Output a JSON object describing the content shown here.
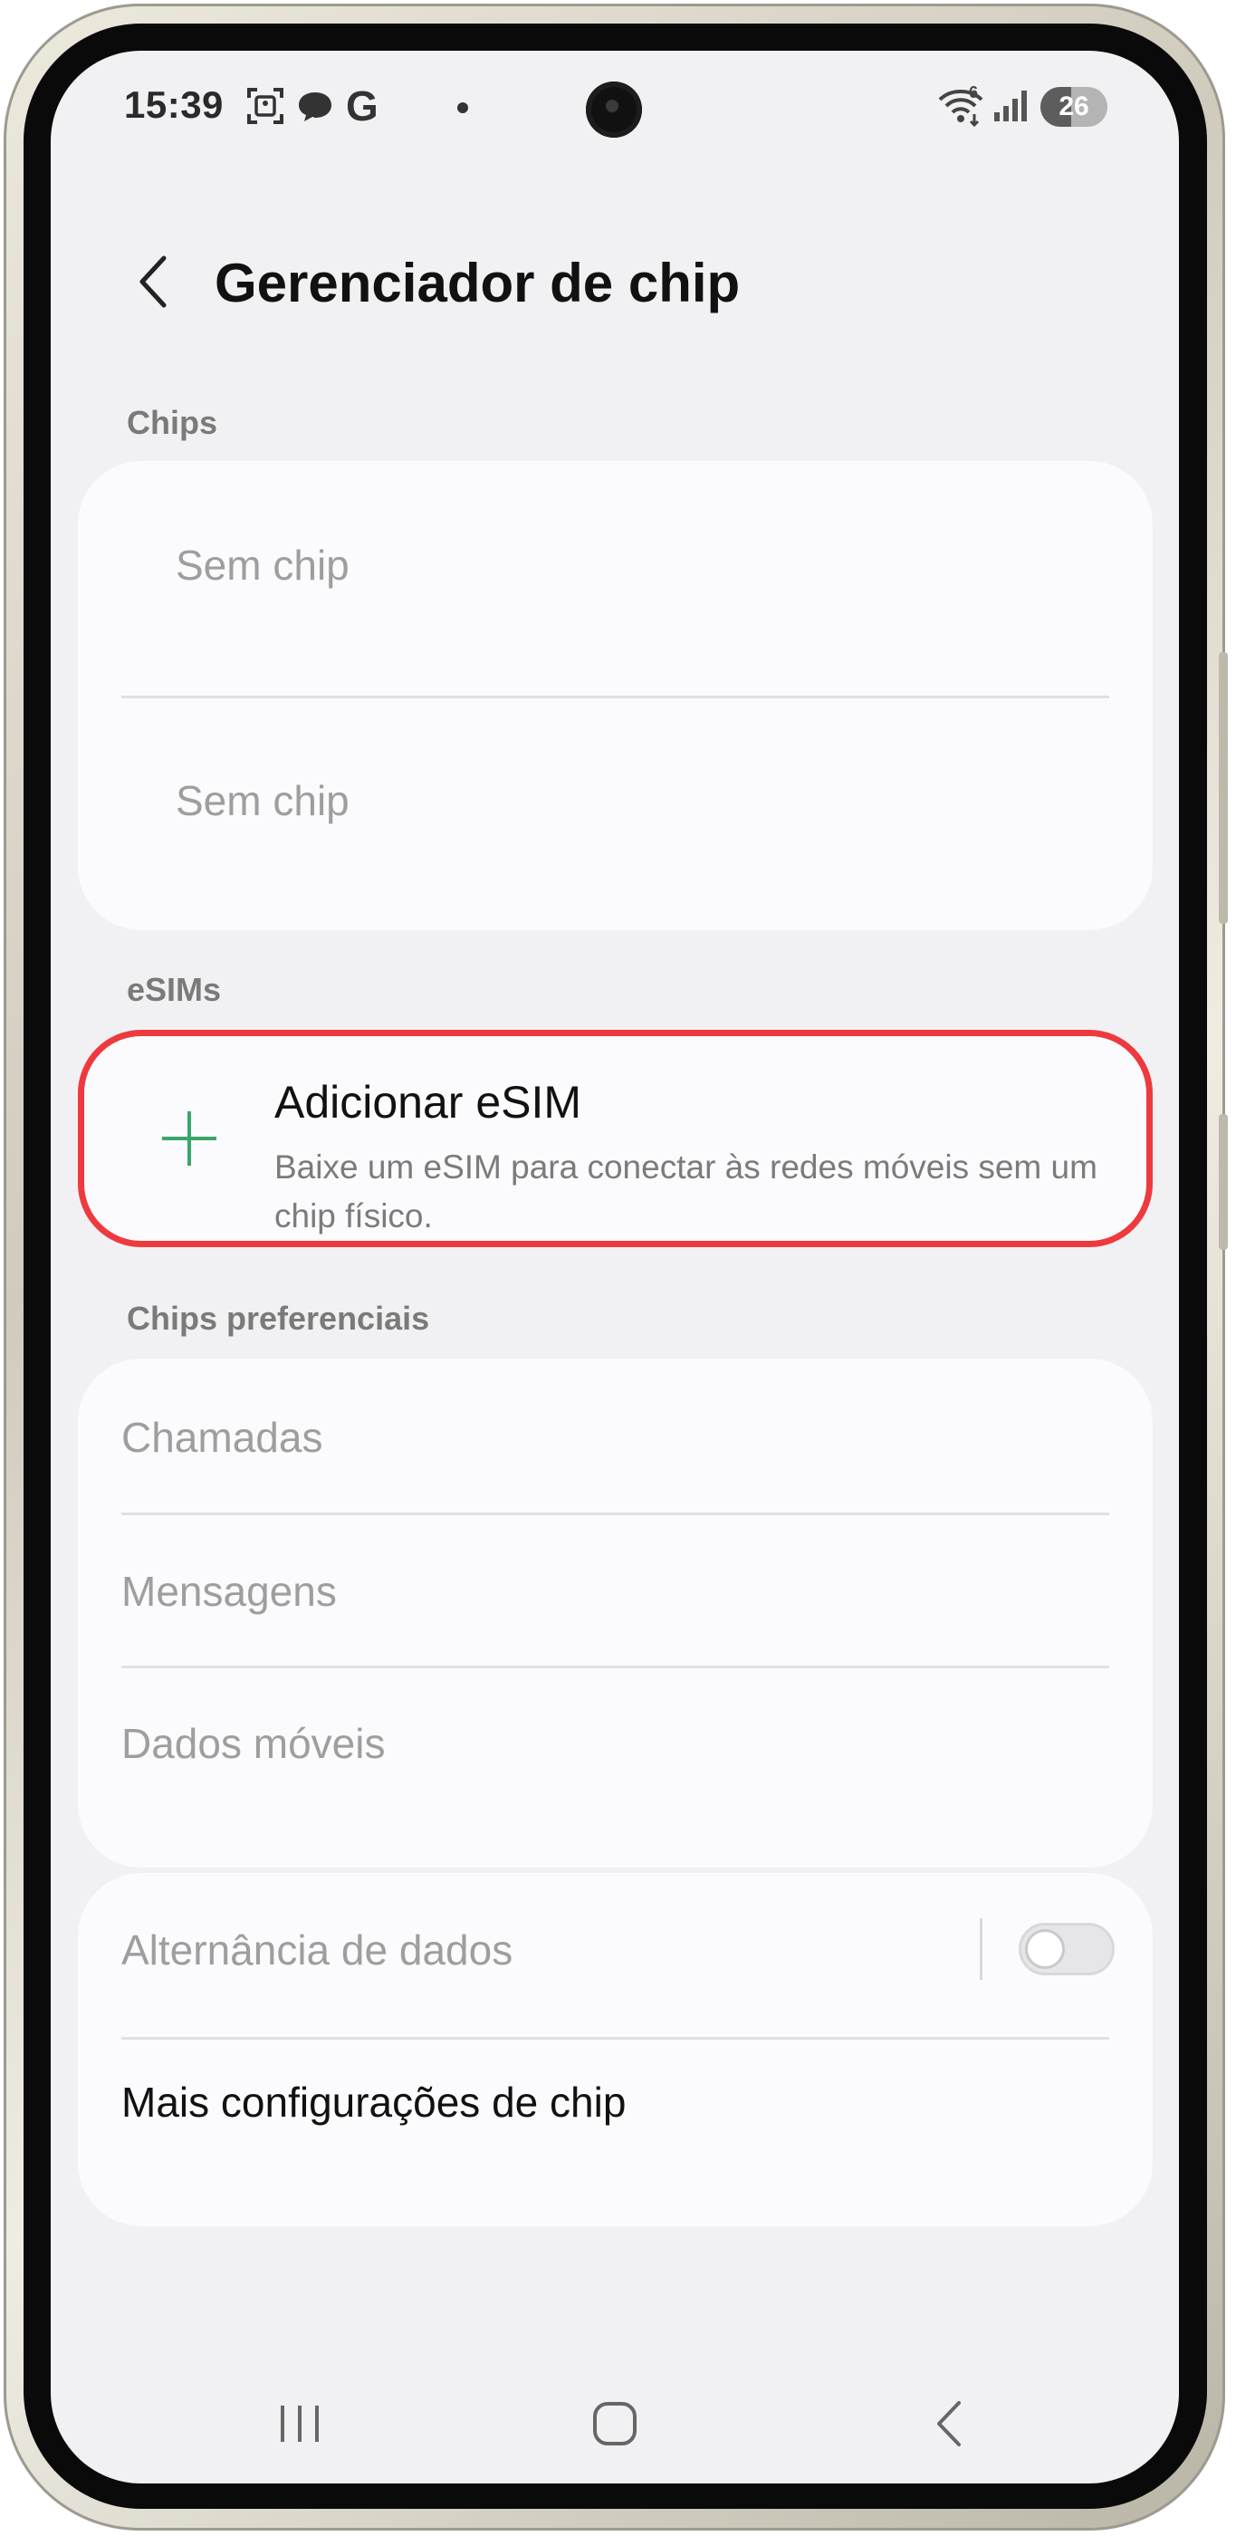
{
  "status_bar": {
    "time": "15:39",
    "icons": [
      "screenshot-icon",
      "chat-bubble-icon",
      "google-g-icon",
      "dot-icon"
    ],
    "google_letter": "G",
    "right_icons": [
      "wifi-6-icon",
      "signal-icon"
    ],
    "wifi_badge": "6",
    "battery_level": "26"
  },
  "header": {
    "title": "Gerenciador de chip"
  },
  "chips": {
    "section_label": "Chips",
    "items": [
      "Sem chip",
      "Sem chip"
    ]
  },
  "esims": {
    "section_label": "eSIMs",
    "add_title": "Adicionar eSIM",
    "add_desc": "Baixe um eSIM para conectar às redes móveis sem um chip físico.",
    "highlight_color": "#ee3a3f",
    "accent_color": "#3aa66a"
  },
  "preferred": {
    "section_label": "Chips preferenciais",
    "items": [
      "Chamadas",
      "Mensagens",
      "Dados móveis"
    ]
  },
  "settings": {
    "data_switch_label": "Alternância de dados",
    "data_switch_on": false,
    "more_label": "Mais configurações de chip"
  },
  "nav": {
    "icons": [
      "recents-icon",
      "home-icon",
      "back-icon"
    ]
  }
}
